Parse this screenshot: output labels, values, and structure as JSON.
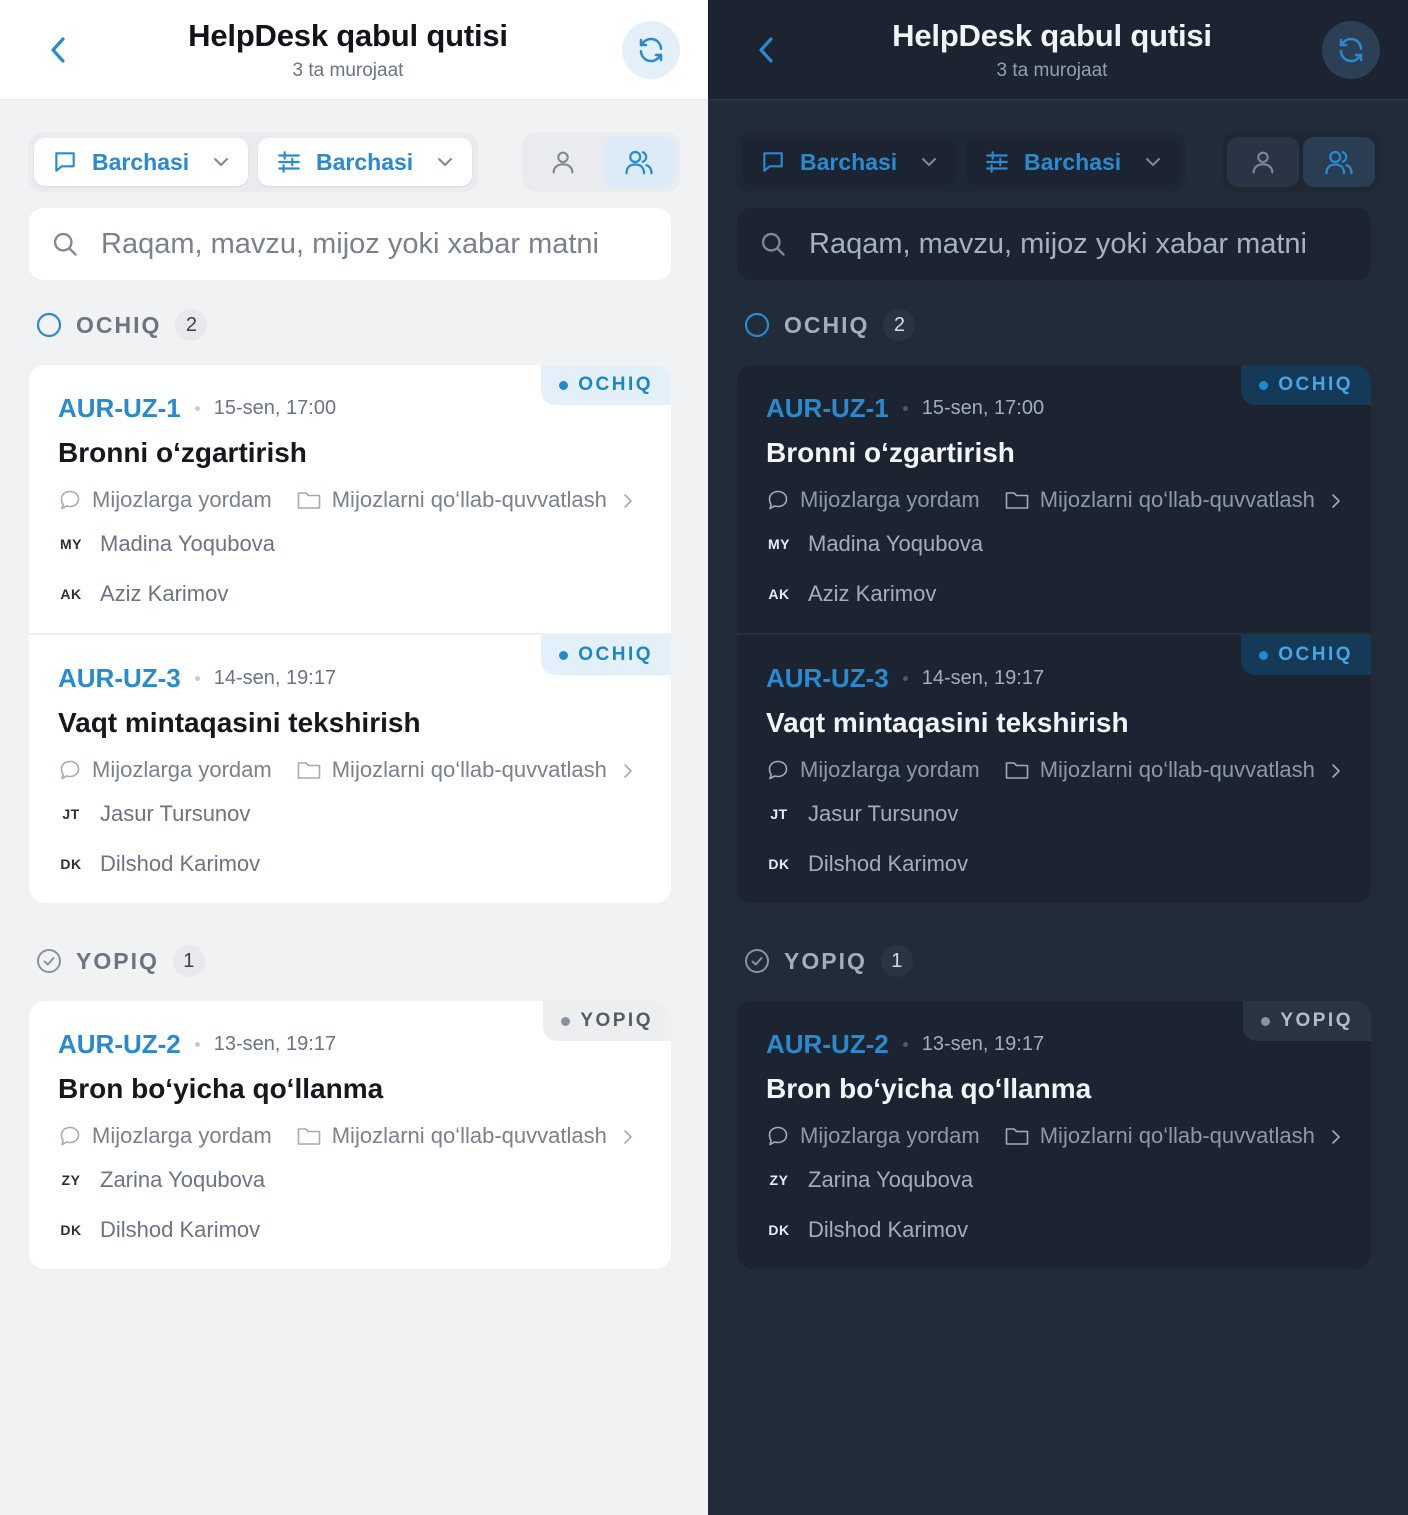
{
  "header": {
    "title": "HelpDesk qabul qutisi",
    "subtitle": "3 ta murojaat"
  },
  "filters": {
    "channel_label": "Barchasi",
    "status_label": "Barchasi"
  },
  "search": {
    "placeholder": "Raqam, mavzu, mijoz yoki xabar matni"
  },
  "sections": {
    "open": {
      "label": "OCHIQ",
      "count": "2"
    },
    "closed": {
      "label": "YOPIQ",
      "count": "1"
    }
  },
  "tickets": [
    {
      "id": "AUR-UZ-1",
      "date": "15-sen, 17:00",
      "subject": "Bronni o‘zgartirish",
      "status": "OCHIQ",
      "channel": "Mijozlarga yordam",
      "team": "Mijozlarni qo‘llab-quvvatlash",
      "customer_initials": "MY",
      "customer": "Madina Yoqubova",
      "agent_initials": "AK",
      "agent": "Aziz Karimov"
    },
    {
      "id": "AUR-UZ-3",
      "date": "14-sen, 19:17",
      "subject": "Vaqt mintaqasini tekshirish",
      "status": "OCHIQ",
      "channel": "Mijozlarga yordam",
      "team": "Mijozlarni qo‘llab-quvvatlash",
      "customer_initials": "JT",
      "customer": "Jasur Tursunov",
      "agent_initials": "DK",
      "agent": "Dilshod Karimov"
    },
    {
      "id": "AUR-UZ-2",
      "date": "13-sen, 19:17",
      "subject": "Bron bo‘yicha qo‘llanma",
      "status": "YOPIQ",
      "channel": "Mijozlarga yordam",
      "team": "Mijozlarni qo‘llab-quvvatlash",
      "customer_initials": "ZY",
      "customer": "Zarina Yoqubova",
      "agent_initials": "DK",
      "agent": "Dilshod Karimov"
    }
  ],
  "colors": {
    "accent": "#2a8ad0",
    "light_bg": "#f1f2f4",
    "dark_bg": "#212c38"
  },
  "icons": {
    "back": "chevron-left-icon",
    "refresh": "refresh-icon",
    "channel_filter": "chat-bubble-icon",
    "status_filter": "sliders-icon",
    "my_view": "user-icon",
    "team_view": "users-icon",
    "search": "search-icon",
    "open_section": "circle-icon",
    "closed_section": "check-circle-icon"
  }
}
